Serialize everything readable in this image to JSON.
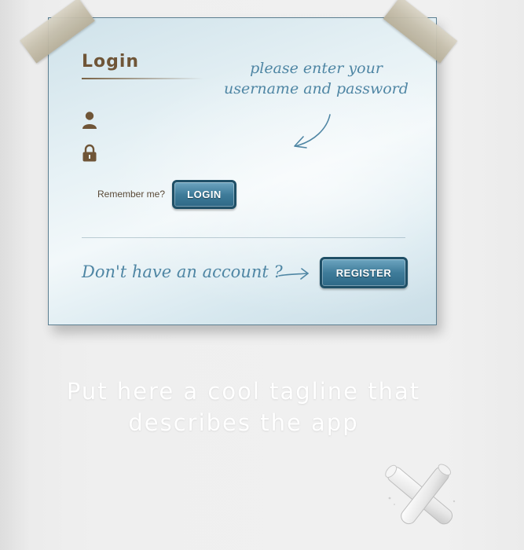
{
  "login": {
    "title": "Login",
    "instruction_line1": "please enter your",
    "instruction_line2": "username and password",
    "username_value": "",
    "password_value": "",
    "remember_label": "Remember me?",
    "login_button": "LOGIN"
  },
  "register": {
    "prompt": "Don't have an account ?",
    "button": "REGISTER"
  },
  "tagline": {
    "line1": "Put here a cool tagline that",
    "line2": "describes the app"
  },
  "icons": {
    "user": "user-icon",
    "lock": "lock-icon",
    "arrow": "hand-drawn-arrow-icon",
    "chalk": "chalk-icon"
  },
  "colors": {
    "brown": "#6f5537",
    "blue_text": "#4f86a4",
    "button_border": "#1f4f66",
    "card_border": "#5d7f91"
  }
}
